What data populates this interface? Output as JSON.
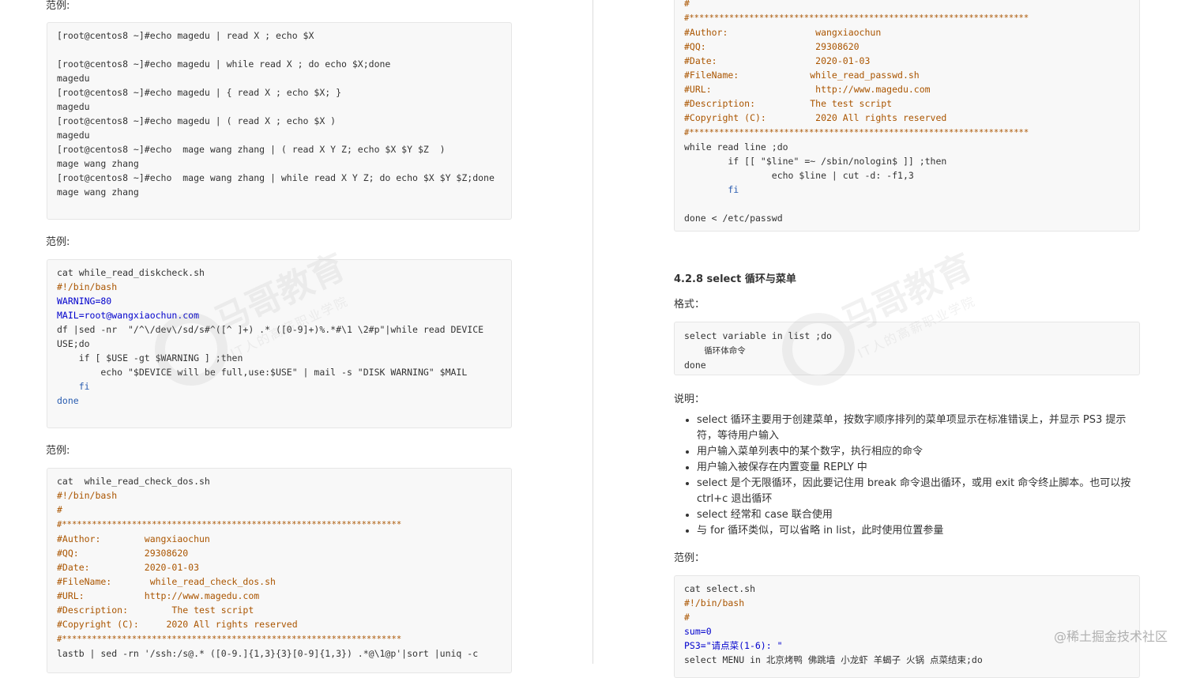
{
  "left": {
    "example_label": "范例:",
    "block1_lines": [
      "[root@centos8 ~]#echo magedu | read X ; echo $X",
      "",
      "[root@centos8 ~]#echo magedu | while read X ; do echo $X;done",
      "magedu",
      "[root@centos8 ~]#echo magedu | { read X ; echo $X; }",
      "magedu",
      "[root@centos8 ~]#echo magedu | ( read X ; echo $X )",
      "magedu",
      "[root@centos8 ~]#echo  mage wang zhang | ( read X Y Z; echo $X $Y $Z  )",
      "mage wang zhang",
      "[root@centos8 ~]#echo  mage wang zhang | while read X Y Z; do echo $X $Y $Z;done",
      "mage wang zhang"
    ],
    "block2_lines": [
      "cat while_read_diskcheck.sh",
      "#!/bin/bash",
      "WARNING=80",
      "MAIL=root@wangxiaochun.com",
      "df |sed -nr  \"/^\\/dev\\/sd/s#^([^ ]+) .* ([0-9]+)%.*#\\1 \\2#p\"|while read DEVICE",
      "USE;do",
      "    if [ $USE -gt $WARNING ] ;then",
      "        echo \"$DEVICE will be full,use:$USE\" | mail -s \"DISK WARNING\" $MAIL",
      "    fi",
      "done"
    ],
    "block3_lines": [
      "cat  while_read_check_dos.sh",
      "#!/bin/bash",
      "#",
      "#********************************************************************",
      "#Author:        wangxiaochun",
      "#QQ:            29308620",
      "#Date:          2020-01-03",
      "#FileName:       while_read_check_dos.sh",
      "#URL:           http://www.magedu.com",
      "#Description:        The test script",
      "#Copyright (C):     2020 All rights reserved",
      "#********************************************************************",
      "lastb | sed -rn '/ssh:/s@.* ([0-9.]{1,3}{3}[0-9]{1,3}) .*@\\1@p'|sort |uniq -c"
    ]
  },
  "right": {
    "top_code_lines": [
      "#",
      "#********************************************************************",
      "#Author:                wangxiaochun",
      "#QQ:                    29308620",
      "#Date:                  2020-01-03",
      "#FileName:             while_read_passwd.sh",
      "#URL:                   http://www.magedu.com",
      "#Description:          The test script",
      "#Copyright (C):         2020 All rights reserved",
      "#********************************************************************",
      "while read line ;do",
      "        if [[ \"$line\" =~ /sbin/nologin$ ]] ;then",
      "                echo $line | cut -d: -f1,3",
      "        fi",
      "",
      "done < /etc/passwd"
    ],
    "section_heading": "4.2.8 select 循环与菜单",
    "format_label": "格式：",
    "format_line1": "select variable in list ;do",
    "format_line2": "    循环体命令",
    "format_line3": "done",
    "explain_label": "说明：",
    "bullets": [
      "select 循环主要用于创建菜单，按数字顺序排列的菜单项显示在标准错误上，并显示 PS3 提示符，等待用户输入",
      "用户输入菜单列表中的某个数字，执行相应的命令",
      "用户输入被保存在内置变量 REPLY 中",
      "select 是个无限循环，因此要记住用 break 命令退出循环，或用 exit 命令终止脚本。也可以按 ctrl+c 退出循环",
      "select 经常和 case 联合使用",
      "与 for 循环类似，可以省略 in list，此时使用位置参量"
    ],
    "example_label": "范例：",
    "bottom_code_lines": [
      "cat select.sh",
      "#!/bin/bash",
      "#",
      "sum=0",
      "PS3=\"请点菜(1-6): \"",
      "select MENU in 北京烤鸭 佛跳墙 小龙虾 羊蝎子 火锅 点菜结束;do"
    ]
  },
  "watermark": {
    "brand": "马哥教育",
    "slogan": "IT人的高薪职业学院"
  },
  "site_mark": "@稀土掘金技术社区"
}
